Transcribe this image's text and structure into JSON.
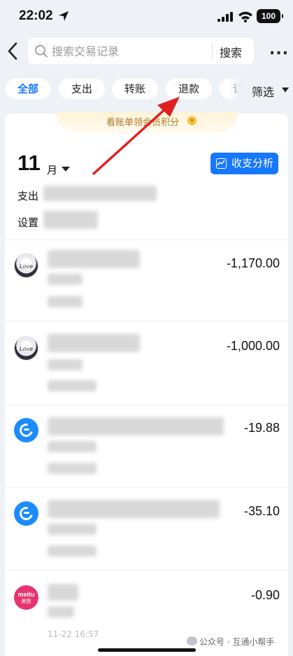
{
  "status": {
    "time": "22:02",
    "battery": "100"
  },
  "search": {
    "placeholder": "搜索交易记录",
    "button": "搜索",
    "more": "···"
  },
  "tabs": [
    {
      "label": "全部",
      "active": true
    },
    {
      "label": "支出",
      "active": false
    },
    {
      "label": "转账",
      "active": false
    },
    {
      "label": "退款",
      "active": false
    },
    {
      "label": "订",
      "active": false
    }
  ],
  "filter": {
    "label": "筛选"
  },
  "promo": {
    "text": "看账单领会员积分"
  },
  "summary": {
    "month": "11",
    "month_unit": "月",
    "analysis_label": "收支分析",
    "expense_prefix": "支出",
    "setting_prefix": "设置"
  },
  "transactions": [
    {
      "icon": "love-app-icon",
      "icon_text": "Love",
      "amount": "-1,170.00"
    },
    {
      "icon": "love-app-icon",
      "icon_text": "Love",
      "amount": "-1,000.00"
    },
    {
      "icon": "eleme-icon",
      "amount": "-19.88"
    },
    {
      "icon": "eleme-icon",
      "amount": "-35.10"
    },
    {
      "icon": "meitu-icon",
      "icon_text_top": "meitu",
      "icon_text_bottom": "美图",
      "amount": "-0.90",
      "date": "11-22 16:57"
    }
  ],
  "watermark": "公众号 · 互通小帮手",
  "colors": {
    "accent": "#1677ff",
    "arrow": "#e02020",
    "meitu": "#e8336e",
    "eleme": "#1a8cff"
  }
}
